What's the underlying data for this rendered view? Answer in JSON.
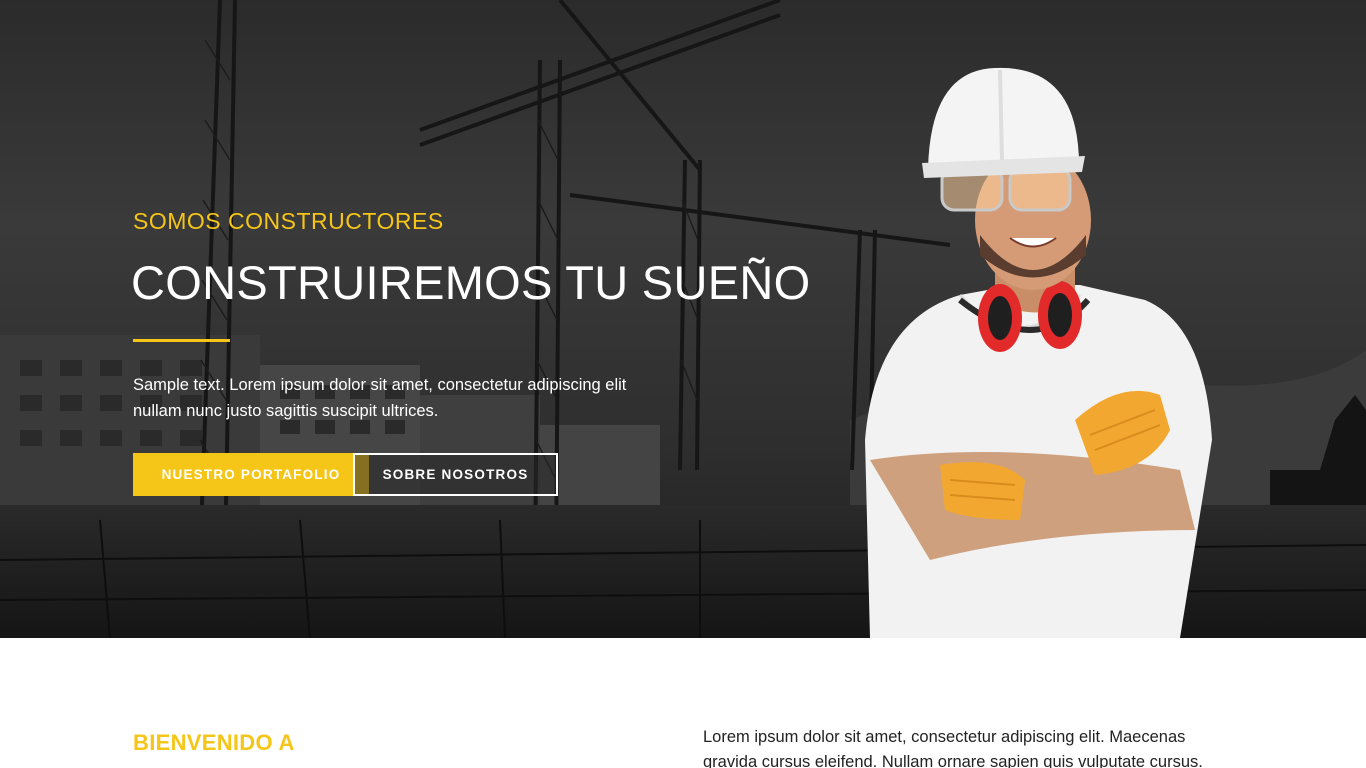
{
  "hero": {
    "eyebrow": "SOMOS CONSTRUCTORES",
    "headline": "CONSTRUIREMOS TU SUEÑO",
    "text": "Sample text. Lorem ipsum dolor sit amet, consectetur adipiscing elit nullam nunc justo sagittis suscipit ultrices.",
    "primary_button": "NUESTRO PORTAFOLIO",
    "secondary_button": "SOBRE NOSOTROS"
  },
  "welcome": {
    "title": "BIENVENIDO A",
    "text": "Lorem ipsum dolor sit amet, consectetur adipiscing elit. Maecenas gravida cursus eleifend. Nullam ornare sapien quis vulputate cursus."
  },
  "colors": {
    "accent": "#f5c518",
    "hero_overlay": "#2b2b2b",
    "text_dark": "#222222"
  }
}
